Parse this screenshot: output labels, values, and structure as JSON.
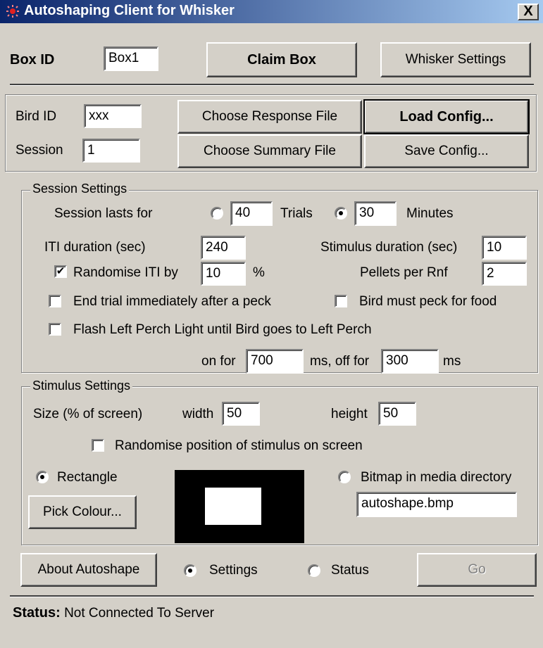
{
  "window": {
    "title": "Autoshaping Client for Whisker",
    "close_label": "X"
  },
  "top": {
    "box_id_label": "Box ID",
    "box_id_value": "Box1",
    "claim_box": "Claim Box",
    "whisker_settings": "Whisker Settings"
  },
  "files": {
    "bird_id_label": "Bird ID",
    "bird_id_value": "xxx",
    "session_label": "Session",
    "session_value": "1",
    "choose_response": "Choose Response File",
    "choose_summary": "Choose Summary File",
    "load_config": "Load Config...",
    "save_config": "Save Config..."
  },
  "session_settings": {
    "title": "Session Settings",
    "lasts_for": "Session lasts for",
    "trials_value": "40",
    "trials_label": "Trials",
    "trials_selected": false,
    "minutes_value": "30",
    "minutes_label": "Minutes",
    "minutes_selected": true,
    "iti_label": "ITI duration (sec)",
    "iti_value": "240",
    "stim_dur_label": "Stimulus duration (sec)",
    "stim_dur_value": "10",
    "randomise_iti_label": "Randomise ITI by",
    "randomise_iti_checked": true,
    "randomise_iti_value": "10",
    "percent": "%",
    "pellets_label": "Pellets per Rnf",
    "pellets_value": "2",
    "end_trial_label": "End trial immediately after a peck",
    "end_trial_checked": false,
    "bird_must_peck_label": "Bird must peck for food",
    "bird_must_peck_checked": false,
    "flash_label": "Flash Left Perch Light until Bird goes to Left Perch",
    "flash_checked": false,
    "on_for_label": "on for",
    "on_for_value": "700",
    "off_for_label": "ms, off for",
    "off_for_value": "300",
    "ms_label": "ms"
  },
  "stimulus_settings": {
    "title": "Stimulus Settings",
    "size_label": "Size (% of screen)",
    "width_label": "width",
    "width_value": "50",
    "height_label": "height",
    "height_value": "50",
    "randomise_pos_label": "Randomise position of stimulus on screen",
    "randomise_pos_checked": false,
    "rectangle_label": "Rectangle",
    "rectangle_selected": true,
    "bitmap_label": "Bitmap in media directory",
    "bitmap_selected": false,
    "bitmap_value": "autoshape.bmp",
    "pick_colour": "Pick Colour..."
  },
  "bottom": {
    "about": "About Autoshape",
    "settings_label": "Settings",
    "settings_selected": true,
    "status_radio_label": "Status",
    "status_radio_selected": false,
    "go": "Go"
  },
  "status": {
    "label": "Status:",
    "text": "Not Connected To Server"
  },
  "colors": {
    "title_start": "#0a246a",
    "title_end": "#a6caf0",
    "face": "#d4d0c8"
  }
}
